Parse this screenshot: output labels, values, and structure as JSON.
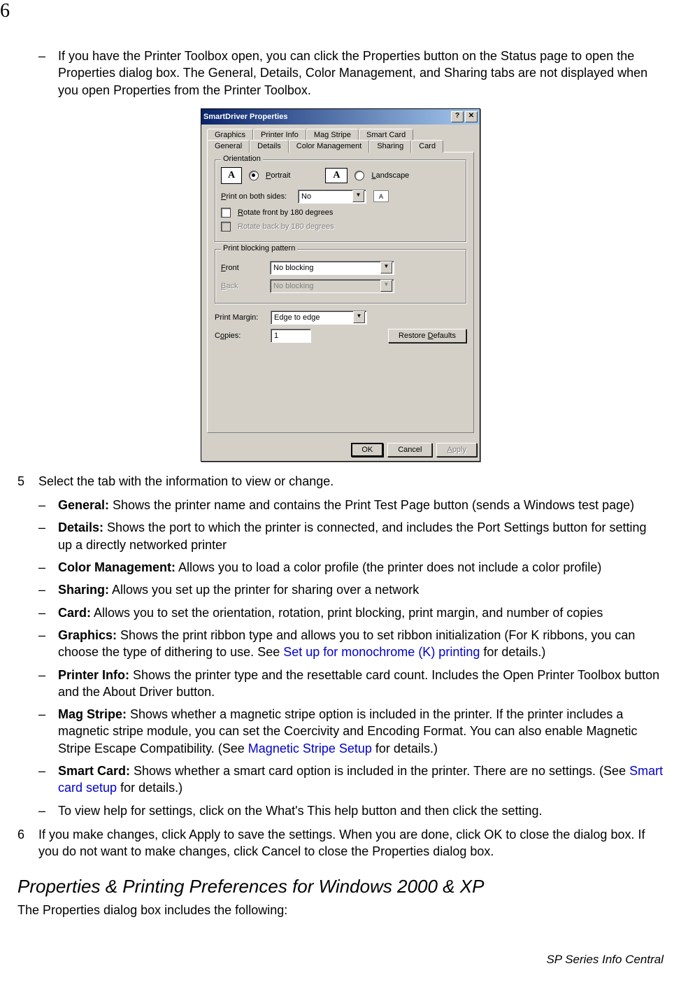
{
  "page_number": "6",
  "intro_para": "If you have the Printer Toolbox open, you can click the Properties button on the Status page to open the Properties dialog box. The General, Details, Color Management, and Sharing tabs are not displayed when you open Properties from the Printer Toolbox.",
  "dialog": {
    "title": "SmartDriver Properties",
    "help_btn": "?",
    "close_btn": "✕",
    "tabs_row1": [
      "Graphics",
      "Printer Info",
      "Mag Stripe",
      "Smart Card"
    ],
    "tabs_row2": [
      "General",
      "Details",
      "Color Management",
      "Sharing",
      "Card"
    ],
    "orientation_legend": "Orientation",
    "portrait_label": "Portrait",
    "landscape_label": "Landscape",
    "print_both_sides_label": "Print on both sides:",
    "print_both_sides_value": "No",
    "rotate_front_label": "Rotate front by 180 degrees",
    "rotate_back_label": "Rotate back by 180 degrees",
    "blocking_legend": "Print blocking pattern",
    "front_label": "Front",
    "front_value": "No blocking",
    "back_label": "Back",
    "back_value": "No blocking",
    "margin_label": "Print Margin:",
    "margin_value": "Edge to edge",
    "copies_label": "Copies:",
    "copies_value": "1",
    "restore_btn": "Restore Defaults",
    "ok_btn": "OK",
    "cancel_btn": "Cancel",
    "apply_btn": "Apply"
  },
  "step5": {
    "num": "5",
    "text": "Select the tab with the information to view or change."
  },
  "tab_desc": {
    "general_b": "General:",
    "general_t": " Shows the printer name and contains the Print Test Page button (sends a Windows test page)",
    "details_b": "Details:",
    "details_t": " Shows the port to which the printer is connected, and includes the Port Settings button for setting up a directly networked printer",
    "color_b": "Color Management:",
    "color_t": " Allows you to load a color profile (the printer does not include a color profile)",
    "sharing_b": "Sharing:",
    "sharing_t": " Allows you set up the printer for sharing over a network",
    "card_b": "Card:",
    "card_t": " Allows you to set the orientation, rotation, print blocking, print margin, and number of copies",
    "graphics_b": "Graphics:",
    "graphics_t1": " Shows the print ribbon type and allows you to set ribbon initialization (For K ribbons, you can choose the type of dithering to use. See ",
    "graphics_link": "Set up for monochrome (K) printing",
    "graphics_t2": " for details.)",
    "printer_b": "Printer Info:",
    "printer_t": " Shows the printer type and the resettable card count. Includes the Open Printer Toolbox button and the About Driver button.",
    "mag_b": "Mag Stripe:",
    "mag_t1": " Shows whether a magnetic stripe option is included in the printer. If the printer includes a magnetic stripe module, you can set the Coercivity and Encoding Format. You can also enable Magnetic Stripe Escape Compatibility. (See ",
    "mag_link": "Magnetic Stripe Setup",
    "mag_t2": " for details.)",
    "smart_b": "Smart Card:",
    "smart_t1": " Shows whether a smart card option is included in the printer. There are no settings. (See ",
    "smart_link": "Smart card setup",
    "smart_t2": " for details.)",
    "help_t": "To view help for settings, click on the What's This help button and then click the setting."
  },
  "step6": {
    "num": "6",
    "text": "If you make changes, click Apply to save the settings. When you are done, click OK to close the dialog box. If you do not want to make changes, click Cancel to close the Properties dialog box."
  },
  "section_heading": "Properties & Printing Preferences for Windows 2000 & XP",
  "section_intro": "The Properties dialog box includes the following:",
  "footer": "SP Series Info Central"
}
